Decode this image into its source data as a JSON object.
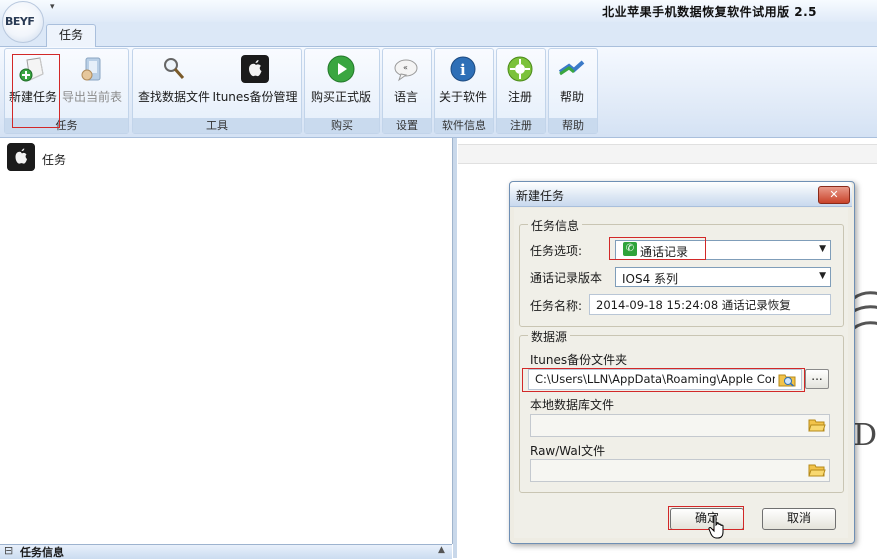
{
  "app": {
    "title": "北业苹果手机数据恢复软件试用版 2.5",
    "logo_text": "BEYF"
  },
  "tabs": [
    {
      "label": "任务"
    }
  ],
  "ribbon": {
    "buttons": {
      "new_task": "新建任务",
      "export_current": "导出当前表",
      "find_data_file": "查找数据文件",
      "itunes_backup": "Itunes备份管理",
      "buy": "购买正式版",
      "language": "语言",
      "about": "关于软件",
      "register": "注册",
      "help": "帮助"
    },
    "groups": {
      "task": "任务",
      "tools": "工具",
      "purchase": "购买",
      "settings": "设置",
      "software_info": "软件信息",
      "register": "注册",
      "help": "帮助"
    }
  },
  "left_pane": {
    "tree_root": "任务",
    "bottom_panel_title": "任务信息"
  },
  "dialog": {
    "title": "新建任务",
    "close_symbol": "✕",
    "task_info": {
      "legend": "任务信息",
      "option_label": "任务选项:",
      "option_value": "通话记录",
      "version_label": "通话记录版本",
      "version_value": "IOS4 系列",
      "name_label": "任务名称:",
      "name_value": "2014-09-18 15:24:08 通话记录恢复"
    },
    "data_source": {
      "legend": "数据源",
      "itunes_label": "Itunes备份文件夹",
      "itunes_value": "C:\\Users\\LLN\\AppData\\Roaming\\Apple Computer\\",
      "browse_label": "...",
      "local_db_label": "本地数据库文件",
      "local_db_value": "",
      "rawwal_label": "Raw/Wal文件",
      "rawwal_value": ""
    },
    "ok_label": "确定",
    "cancel_label": "取消"
  },
  "colors": {
    "ribbon_bg": "#dfe9f7",
    "highlight_red": "#d22828",
    "accent_blue": "#2e6fb7",
    "play_green": "#3aa640"
  }
}
